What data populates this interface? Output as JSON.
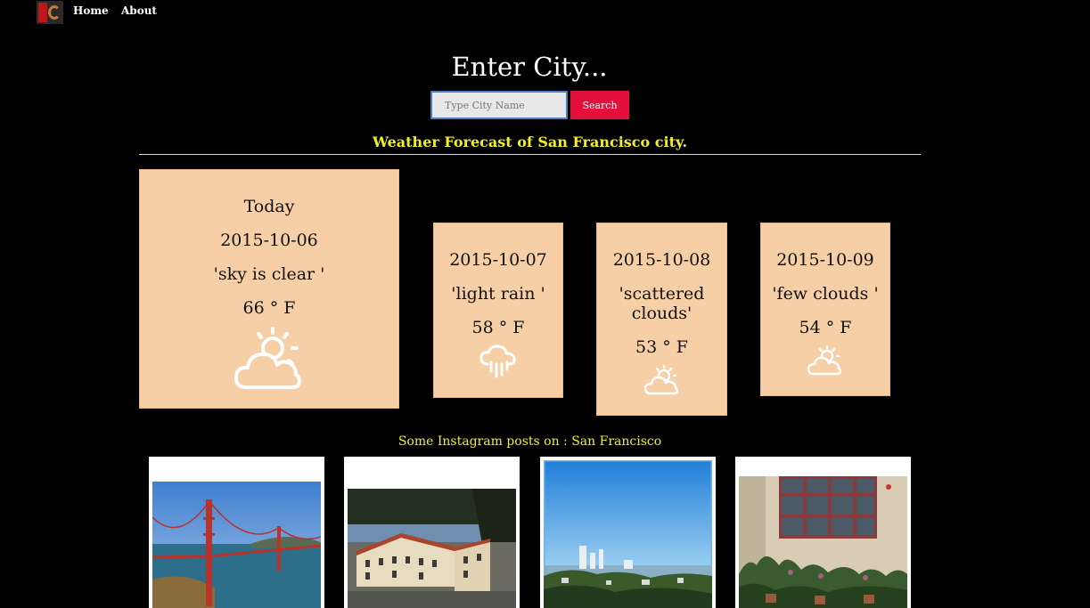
{
  "nav": {
    "logo_alt": "iC",
    "home_label": "Home",
    "about_label": "About"
  },
  "hero": {
    "title": "Enter City...",
    "search_placeholder": "Type City Name",
    "search_value": "",
    "search_button_label": "Search"
  },
  "forecast": {
    "heading": "Weather Forecast of San Francisco city.",
    "today": {
      "label": "Today",
      "date": "2015-10-06",
      "description": "'sky is clear '",
      "temperature": "66 ° F",
      "icon": "partly-cloudy-sun-icon"
    },
    "days": [
      {
        "date": "2015-10-07",
        "description": "'light rain '",
        "temperature": "58 ° F",
        "icon": "rain-cloud-icon"
      },
      {
        "date": "2015-10-08",
        "description": "'scattered clouds'",
        "temperature": "53 ° F",
        "icon": "partly-cloudy-sun-icon"
      },
      {
        "date": "2015-10-09",
        "description": "'few clouds '",
        "temperature": "54 ° F",
        "icon": "partly-cloudy-sun-icon"
      }
    ]
  },
  "instagram": {
    "heading": "Some Instagram posts on : San Francisco",
    "posts": [
      {
        "subject": "golden-gate-bridge-photo"
      },
      {
        "subject": "spanish-style-building-photo"
      },
      {
        "subject": "city-skyline-photo"
      },
      {
        "subject": "building-facade-plants-photo"
      }
    ]
  },
  "colors": {
    "background": "#000000",
    "card": "#f6cfa6",
    "accent_yellow": "#f3f01e",
    "search_button": "#e2103a"
  }
}
